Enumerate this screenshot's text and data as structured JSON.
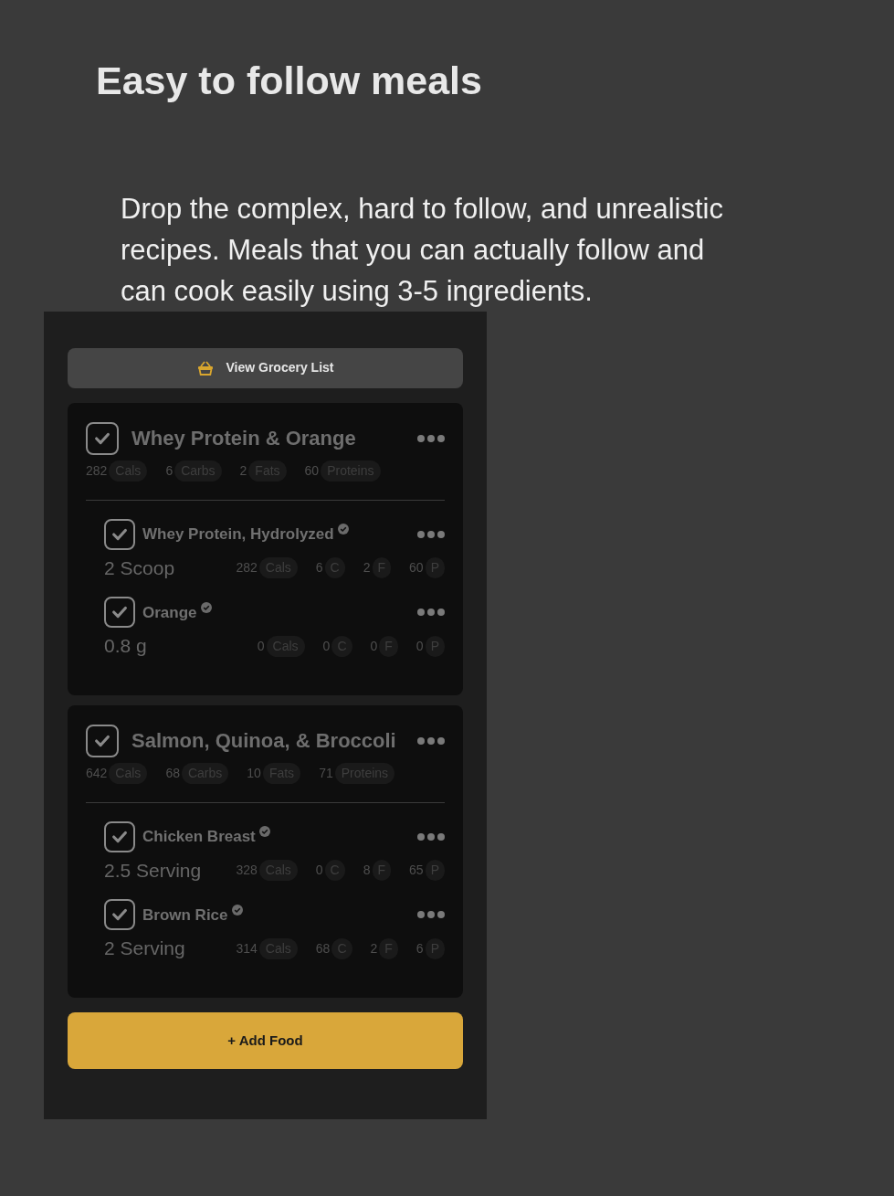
{
  "heading": "Easy to follow meals",
  "description": "Drop the complex, hard to follow, and unrealistic recipes. Meals that you can actually follow and can cook easily using 3-5 ingredients.",
  "grocery_button": {
    "label": "View Grocery List"
  },
  "meals": [
    {
      "name": "Whey Protein & Orange",
      "checked": true,
      "macros": [
        {
          "qty": "282",
          "unit": "Cals"
        },
        {
          "qty": "6",
          "unit": "Carbs"
        },
        {
          "qty": "2",
          "unit": "Fats"
        },
        {
          "qty": "60",
          "unit": "Proteins"
        }
      ],
      "items": [
        {
          "name": "Whey Protein, Hydrolyzed",
          "checked": true,
          "verified": true,
          "amount": "2 Scoop",
          "macros": [
            {
              "qty": "282",
              "unit": "Cals"
            },
            {
              "qty": "6",
              "unit": "C"
            },
            {
              "qty": "2",
              "unit": "F"
            },
            {
              "qty": "60",
              "unit": "P"
            }
          ]
        },
        {
          "name": "Orange",
          "checked": true,
          "verified": true,
          "amount": "0.8 g",
          "macros": [
            {
              "qty": "0",
              "unit": "Cals"
            },
            {
              "qty": "0",
              "unit": "C"
            },
            {
              "qty": "0",
              "unit": "F"
            },
            {
              "qty": "0",
              "unit": "P"
            }
          ]
        }
      ]
    },
    {
      "name": "Salmon, Quinoa, & Broccoli",
      "checked": true,
      "macros": [
        {
          "qty": "642",
          "unit": "Cals"
        },
        {
          "qty": "68",
          "unit": "Carbs"
        },
        {
          "qty": "10",
          "unit": "Fats"
        },
        {
          "qty": "71",
          "unit": "Proteins"
        }
      ],
      "items": [
        {
          "name": "Chicken Breast",
          "checked": true,
          "verified": true,
          "amount": "2.5 Serving",
          "macros": [
            {
              "qty": "328",
              "unit": "Cals"
            },
            {
              "qty": "0",
              "unit": "C"
            },
            {
              "qty": "8",
              "unit": "F"
            },
            {
              "qty": "65",
              "unit": "P"
            }
          ]
        },
        {
          "name": "Brown Rice",
          "checked": true,
          "verified": true,
          "amount": "2 Serving",
          "macros": [
            {
              "qty": "314",
              "unit": "Cals"
            },
            {
              "qty": "68",
              "unit": "C"
            },
            {
              "qty": "2",
              "unit": "F"
            },
            {
              "qty": "6",
              "unit": "P"
            }
          ]
        }
      ]
    }
  ],
  "add_button": {
    "label": "+ Add Food"
  }
}
